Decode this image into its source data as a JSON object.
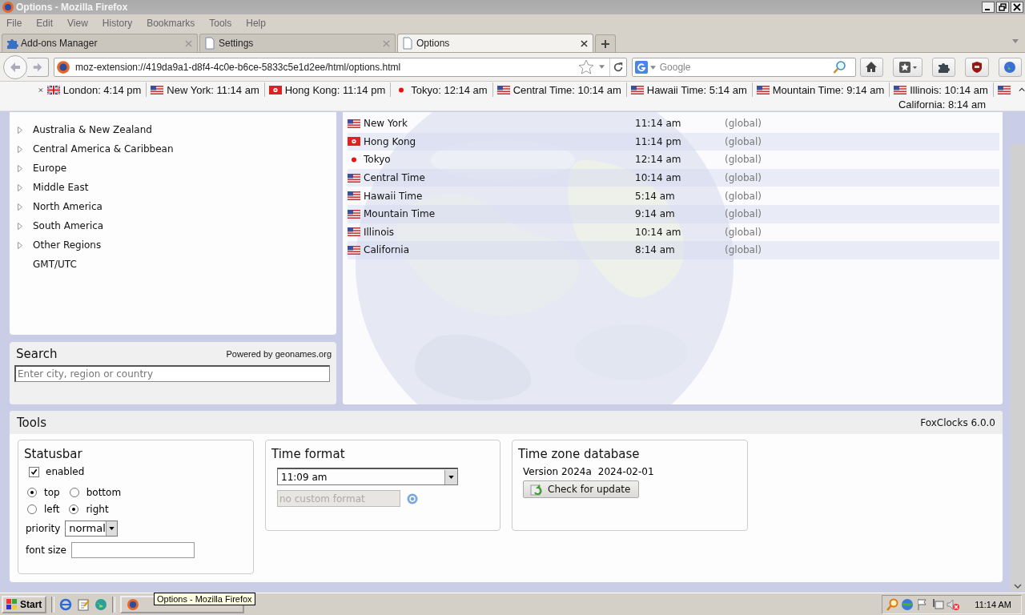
{
  "window": {
    "title": "Options - Mozilla Firefox"
  },
  "menu": [
    "File",
    "Edit",
    "View",
    "History",
    "Bookmarks",
    "Tools",
    "Help"
  ],
  "tabs": [
    {
      "label": "Add-ons Manager",
      "kind": "puzzle",
      "selected": false
    },
    {
      "label": "Settings",
      "kind": "page",
      "selected": false
    },
    {
      "label": "Options",
      "kind": "page",
      "selected": true
    }
  ],
  "address_bar": {
    "url": "moz-extension://419da9a1-d8f4-4c0e-b6ce-5833c5e1d2ee/html/options.html"
  },
  "search_bar": {
    "placeholder": "Google"
  },
  "clock_bar": {
    "clocks": [
      {
        "kind": "uk",
        "label": "London: 4:14 pm"
      },
      {
        "kind": "us",
        "label": "New York: 11:14 am"
      },
      {
        "kind": "hk",
        "label": "Hong Kong: 11:14 pm"
      },
      {
        "kind": "jp",
        "label": "Tokyo: 12:14 am"
      },
      {
        "kind": "us",
        "label": "Central Time: 10:14 am"
      },
      {
        "kind": "us",
        "label": "Hawaii Time: 5:14 am"
      },
      {
        "kind": "us",
        "label": "Mountain Time: 9:14 am"
      },
      {
        "kind": "us",
        "label": "Illinois: 10:14 am"
      },
      {
        "kind": "us",
        "label": "California: 8:14 am"
      }
    ]
  },
  "regions": [
    {
      "label": "Australia & New Zealand",
      "expandable": true
    },
    {
      "label": "Central America & Caribbean",
      "expandable": true
    },
    {
      "label": "Europe",
      "expandable": true
    },
    {
      "label": "Middle East",
      "expandable": true
    },
    {
      "label": "North America",
      "expandable": true
    },
    {
      "label": "South America",
      "expandable": true
    },
    {
      "label": "Other Regions",
      "expandable": true
    },
    {
      "label": "GMT/UTC",
      "expandable": false
    }
  ],
  "search": {
    "title": "Search",
    "credit": "Powered by geonames.org",
    "placeholder": "Enter city, region or country"
  },
  "zones": [
    {
      "kind": "us",
      "name": "New York",
      "time": "11:14 am",
      "scope": "(global)"
    },
    {
      "kind": "hk",
      "name": "Hong Kong",
      "time": "11:14 pm",
      "scope": "(global)"
    },
    {
      "kind": "jp",
      "name": "Tokyo",
      "time": "12:14 am",
      "scope": "(global)"
    },
    {
      "kind": "us",
      "name": "Central Time",
      "time": "10:14 am",
      "scope": "(global)"
    },
    {
      "kind": "us",
      "name": "Hawaii Time",
      "time": "5:14 am",
      "scope": "(global)"
    },
    {
      "kind": "us",
      "name": "Mountain Time",
      "time": "9:14 am",
      "scope": "(global)"
    },
    {
      "kind": "us",
      "name": "Illinois",
      "time": "10:14 am",
      "scope": "(global)"
    },
    {
      "kind": "us",
      "name": "California",
      "time": "8:14 am",
      "scope": "(global)"
    }
  ],
  "tools": {
    "title": "Tools",
    "version": "FoxClocks 6.0.0",
    "statusbar": {
      "title": "Statusbar",
      "enabled": {
        "label": "enabled",
        "checked": true
      },
      "vertical": [
        {
          "label": "top",
          "selected": true
        },
        {
          "label": "bottom",
          "selected": false
        }
      ],
      "horizontal": [
        {
          "label": "left",
          "selected": false
        },
        {
          "label": "right",
          "selected": true
        }
      ],
      "priority": {
        "label": "priority",
        "value": "normal"
      },
      "font_size": {
        "label": "font size"
      }
    },
    "time_format": {
      "title": "Time format",
      "value": "11:09 am",
      "custom_placeholder": "no custom format",
      "custom_disabled": true
    },
    "database": {
      "title": "Time zone database",
      "version": "Version 2024a",
      "date": "2024-02-01",
      "button": "Check for update"
    }
  },
  "taskbar": {
    "start": "Start",
    "tooltip": "Options - Mozilla Firefox",
    "clock": "11:14 AM"
  }
}
